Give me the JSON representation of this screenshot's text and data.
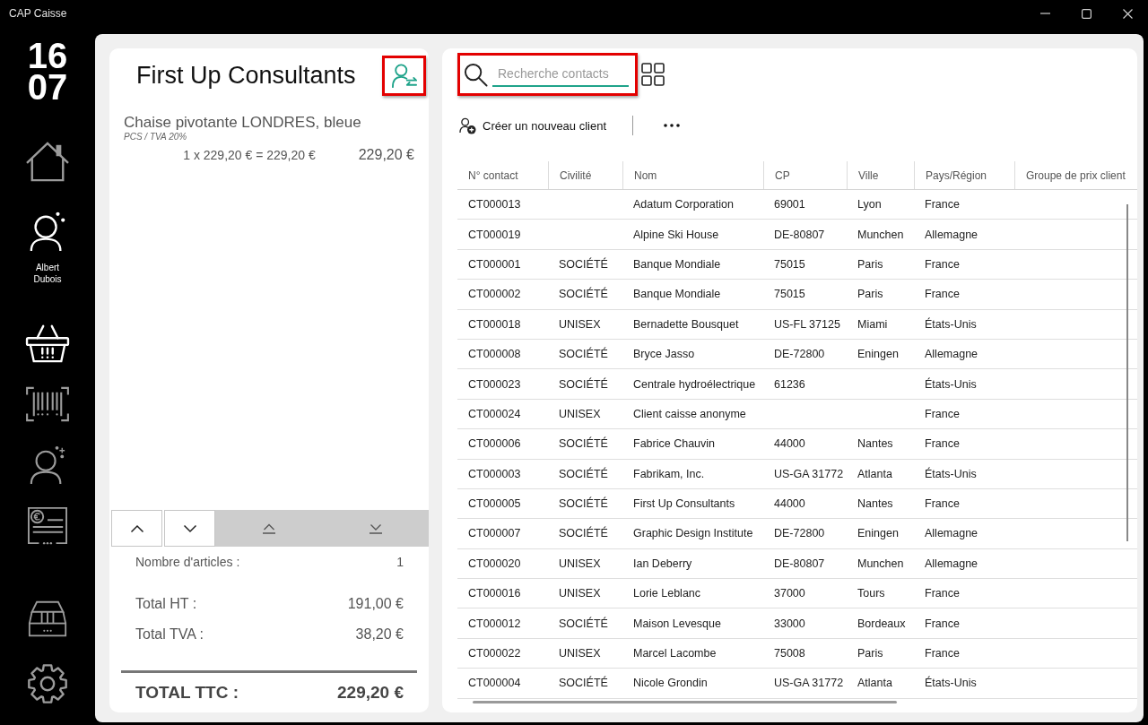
{
  "window": {
    "title": "CAP Caisse"
  },
  "sidebar": {
    "clock": {
      "hours": "16",
      "minutes": "07"
    },
    "items": [
      {
        "kind": "home",
        "active": false
      },
      {
        "kind": "user",
        "label": "Albert Dubois",
        "active": true
      },
      {
        "kind": "basket",
        "active": true
      },
      {
        "kind": "barcode",
        "active": false
      },
      {
        "kind": "customer",
        "active": false
      },
      {
        "kind": "invoice",
        "active": false
      }
    ],
    "bottom_items": [
      {
        "kind": "drawer",
        "active": false
      },
      {
        "kind": "settings",
        "active": false
      }
    ]
  },
  "cart": {
    "customer": "First Up Consultants",
    "change_customer": {
      "highlighted": true
    },
    "lines": [
      {
        "description": "Chaise pivotante LONDRES, bleue",
        "unit_tax": "PCS / TVA 20%",
        "calculation": "1 x 229,20 € = 229,20 €",
        "amount": "229,20 €"
      }
    ],
    "item_count": {
      "label": "Nombre d'articles :",
      "value": "1"
    },
    "totals": [
      {
        "label": "Total HT :",
        "value": "191,00 €"
      },
      {
        "label": "Total TVA :",
        "value": "38,20 €"
      }
    ],
    "grand_total": {
      "label": "TOTAL TTC :",
      "value": "229,20 €"
    }
  },
  "contacts": {
    "search": {
      "placeholder": "Recherche contacts",
      "highlighted": true
    },
    "new_client": "Créer un nouveau client",
    "table": {
      "columns": [
        "N° contact",
        "Civilité",
        "Nom",
        "CP",
        "Ville",
        "Pays/Région",
        "Groupe de prix client"
      ],
      "rows": [
        {
          "contact_no": "CT000013",
          "name": "Adatum Corporation",
          "postal_code": "69001",
          "city": "Lyon",
          "country": "France"
        },
        {
          "contact_no": "CT000019",
          "name": "Alpine Ski House",
          "postal_code": "DE-80807",
          "city": "Munchen",
          "country": "Allemagne"
        },
        {
          "contact_no": "CT000001",
          "civility": "SOCIÉTÉ",
          "name": "Banque Mondiale",
          "postal_code": "75015",
          "city": "Paris",
          "country": "France"
        },
        {
          "contact_no": "CT000002",
          "civility": "SOCIÉTÉ",
          "name": "Banque Mondiale",
          "postal_code": "75015",
          "city": "Paris",
          "country": "France"
        },
        {
          "contact_no": "CT000018",
          "civility": "UNISEX",
          "name": "Bernadette Bousquet",
          "postal_code": "US-FL 37125",
          "city": "Miami",
          "country": "États-Unis"
        },
        {
          "contact_no": "CT000008",
          "civility": "SOCIÉTÉ",
          "name": "Bryce Jasso",
          "postal_code": "DE-72800",
          "city": "Eningen",
          "country": "Allemagne"
        },
        {
          "contact_no": "CT000023",
          "civility": "SOCIÉTÉ",
          "name": "Centrale hydroélectrique",
          "postal_code": "61236",
          "country": "États-Unis"
        },
        {
          "contact_no": "CT000024",
          "civility": "UNISEX",
          "name": "Client caisse anonyme",
          "country": "France"
        },
        {
          "contact_no": "CT000006",
          "civility": "SOCIÉTÉ",
          "name": "Fabrice Chauvin",
          "postal_code": "44000",
          "city": "Nantes",
          "country": "France"
        },
        {
          "contact_no": "CT000003",
          "civility": "SOCIÉTÉ",
          "name": "Fabrikam, Inc.",
          "postal_code": "US-GA 31772",
          "city": "Atlanta",
          "country": "États-Unis"
        },
        {
          "contact_no": "CT000005",
          "civility": "SOCIÉTÉ",
          "name": "First Up Consultants",
          "postal_code": "44000",
          "city": "Nantes",
          "country": "France"
        },
        {
          "contact_no": "CT000007",
          "civility": "SOCIÉTÉ",
          "name": "Graphic Design Institute",
          "postal_code": "DE-72800",
          "city": "Eningen",
          "country": "Allemagne"
        },
        {
          "contact_no": "CT000020",
          "civility": "UNISEX",
          "name": "Ian Deberry",
          "postal_code": "DE-80807",
          "city": "Munchen",
          "country": "Allemagne"
        },
        {
          "contact_no": "CT000016",
          "civility": "UNISEX",
          "name": "Lorie Leblanc",
          "postal_code": "37000",
          "city": "Tours",
          "country": "France"
        },
        {
          "contact_no": "CT000012",
          "civility": "SOCIÉTÉ",
          "name": "Maison Levesque",
          "postal_code": "33000",
          "city": "Bordeaux",
          "country": "France"
        },
        {
          "contact_no": "CT000022",
          "civility": "UNISEX",
          "name": "Marcel Lacombe",
          "postal_code": "75008",
          "city": "Paris",
          "country": "France"
        },
        {
          "contact_no": "CT000004",
          "civility": "SOCIÉTÉ",
          "name": "Nicole Grondin",
          "postal_code": "US-GA 31772",
          "city": "Atlanta",
          "country": "États-Unis"
        }
      ]
    }
  }
}
